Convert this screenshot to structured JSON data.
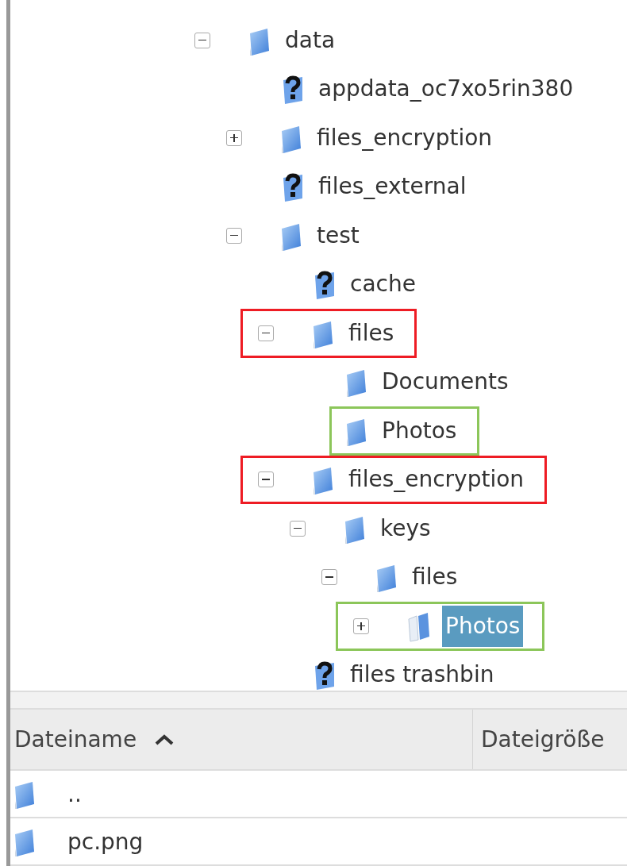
{
  "tree": [
    {
      "name": "data",
      "kind": "folder",
      "expanded": true,
      "selected": false,
      "children": [
        {
          "name": "appdata_oc7xo5rin380",
          "kind": "unknown",
          "selected": false
        },
        {
          "name": "files_encryption",
          "kind": "folder",
          "expanded": false,
          "selected": false
        },
        {
          "name": "files_external",
          "kind": "unknown",
          "selected": false
        },
        {
          "name": "test",
          "kind": "folder",
          "expanded": true,
          "selected": false,
          "children": [
            {
              "name": "cache",
              "kind": "unknown",
              "selected": false
            },
            {
              "name": "files",
              "kind": "folder",
              "expanded": true,
              "selected": false,
              "color": "#ee1c24",
              "children": [
                {
                  "name": "Documents",
                  "kind": "folder",
                  "selected": false
                },
                {
                  "name": "Photos",
                  "kind": "folder",
                  "selected": false,
                  "color": "#8cc65a"
                }
              ]
            },
            {
              "name": "files_encryption",
              "kind": "folder",
              "expanded": true,
              "selected": false,
              "color": "#ee1c24",
              "children": [
                {
                  "name": "keys",
                  "kind": "folder",
                  "expanded": true,
                  "selected": false,
                  "children": [
                    {
                      "name": "files",
                      "kind": "folder",
                      "expanded": true,
                      "selected": false,
                      "children": [
                        {
                          "name": "Photos",
                          "kind": "open",
                          "expanded": false,
                          "selected": true,
                          "color": "#8cc65a"
                        }
                      ]
                    }
                  ]
                }
              ]
            },
            {
              "name": "files trashbin",
              "kind": "unknown",
              "selected": false
            }
          ]
        }
      ]
    }
  ],
  "file_list": {
    "columns": [
      {
        "label": "Dateiname",
        "sorted": true
      },
      {
        "label": "Dateigröße",
        "sorted": false
      }
    ],
    "rows": [
      {
        "name": "..",
        "kind": "folder"
      },
      {
        "name": "pc.png",
        "kind": "folder"
      }
    ]
  }
}
